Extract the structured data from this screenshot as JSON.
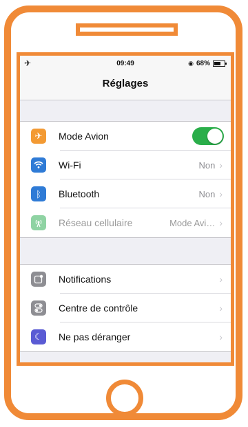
{
  "colors": {
    "phone_frame": "#f08a37",
    "phone_right_tint": "#e57a28",
    "toggle_on": "#2aae4a",
    "icon_airplane": "#f39a33",
    "icon_wifi": "#2f7bd6",
    "icon_bluetooth": "#2f7bd6",
    "icon_cellular": "#8fd3a3",
    "icon_notifications": "#8e8e93",
    "icon_control": "#8e8e93",
    "icon_dnd": "#5a5bd4"
  },
  "statusbar": {
    "airplane_icon": "airplane",
    "time": "09:49",
    "battery_text": "68%"
  },
  "navbar": {
    "title": "Réglages"
  },
  "settings_group_1": [
    {
      "label": "Mode Avion",
      "icon": "airplane-icon",
      "toggle_on": true
    },
    {
      "label": "Wi-Fi",
      "icon": "wifi-icon",
      "value": "Non"
    },
    {
      "label": "Bluetooth",
      "icon": "bluetooth-icon",
      "value": "Non"
    },
    {
      "label": "Réseau cellulaire",
      "icon": "cellular-icon",
      "value": "Mode Avi…",
      "disabled": true
    }
  ],
  "settings_group_2": [
    {
      "label": "Notifications",
      "icon": "notifications-icon"
    },
    {
      "label": "Centre de contrôle",
      "icon": "control-center-icon"
    },
    {
      "label": "Ne pas déranger",
      "icon": "moon-icon"
    }
  ]
}
